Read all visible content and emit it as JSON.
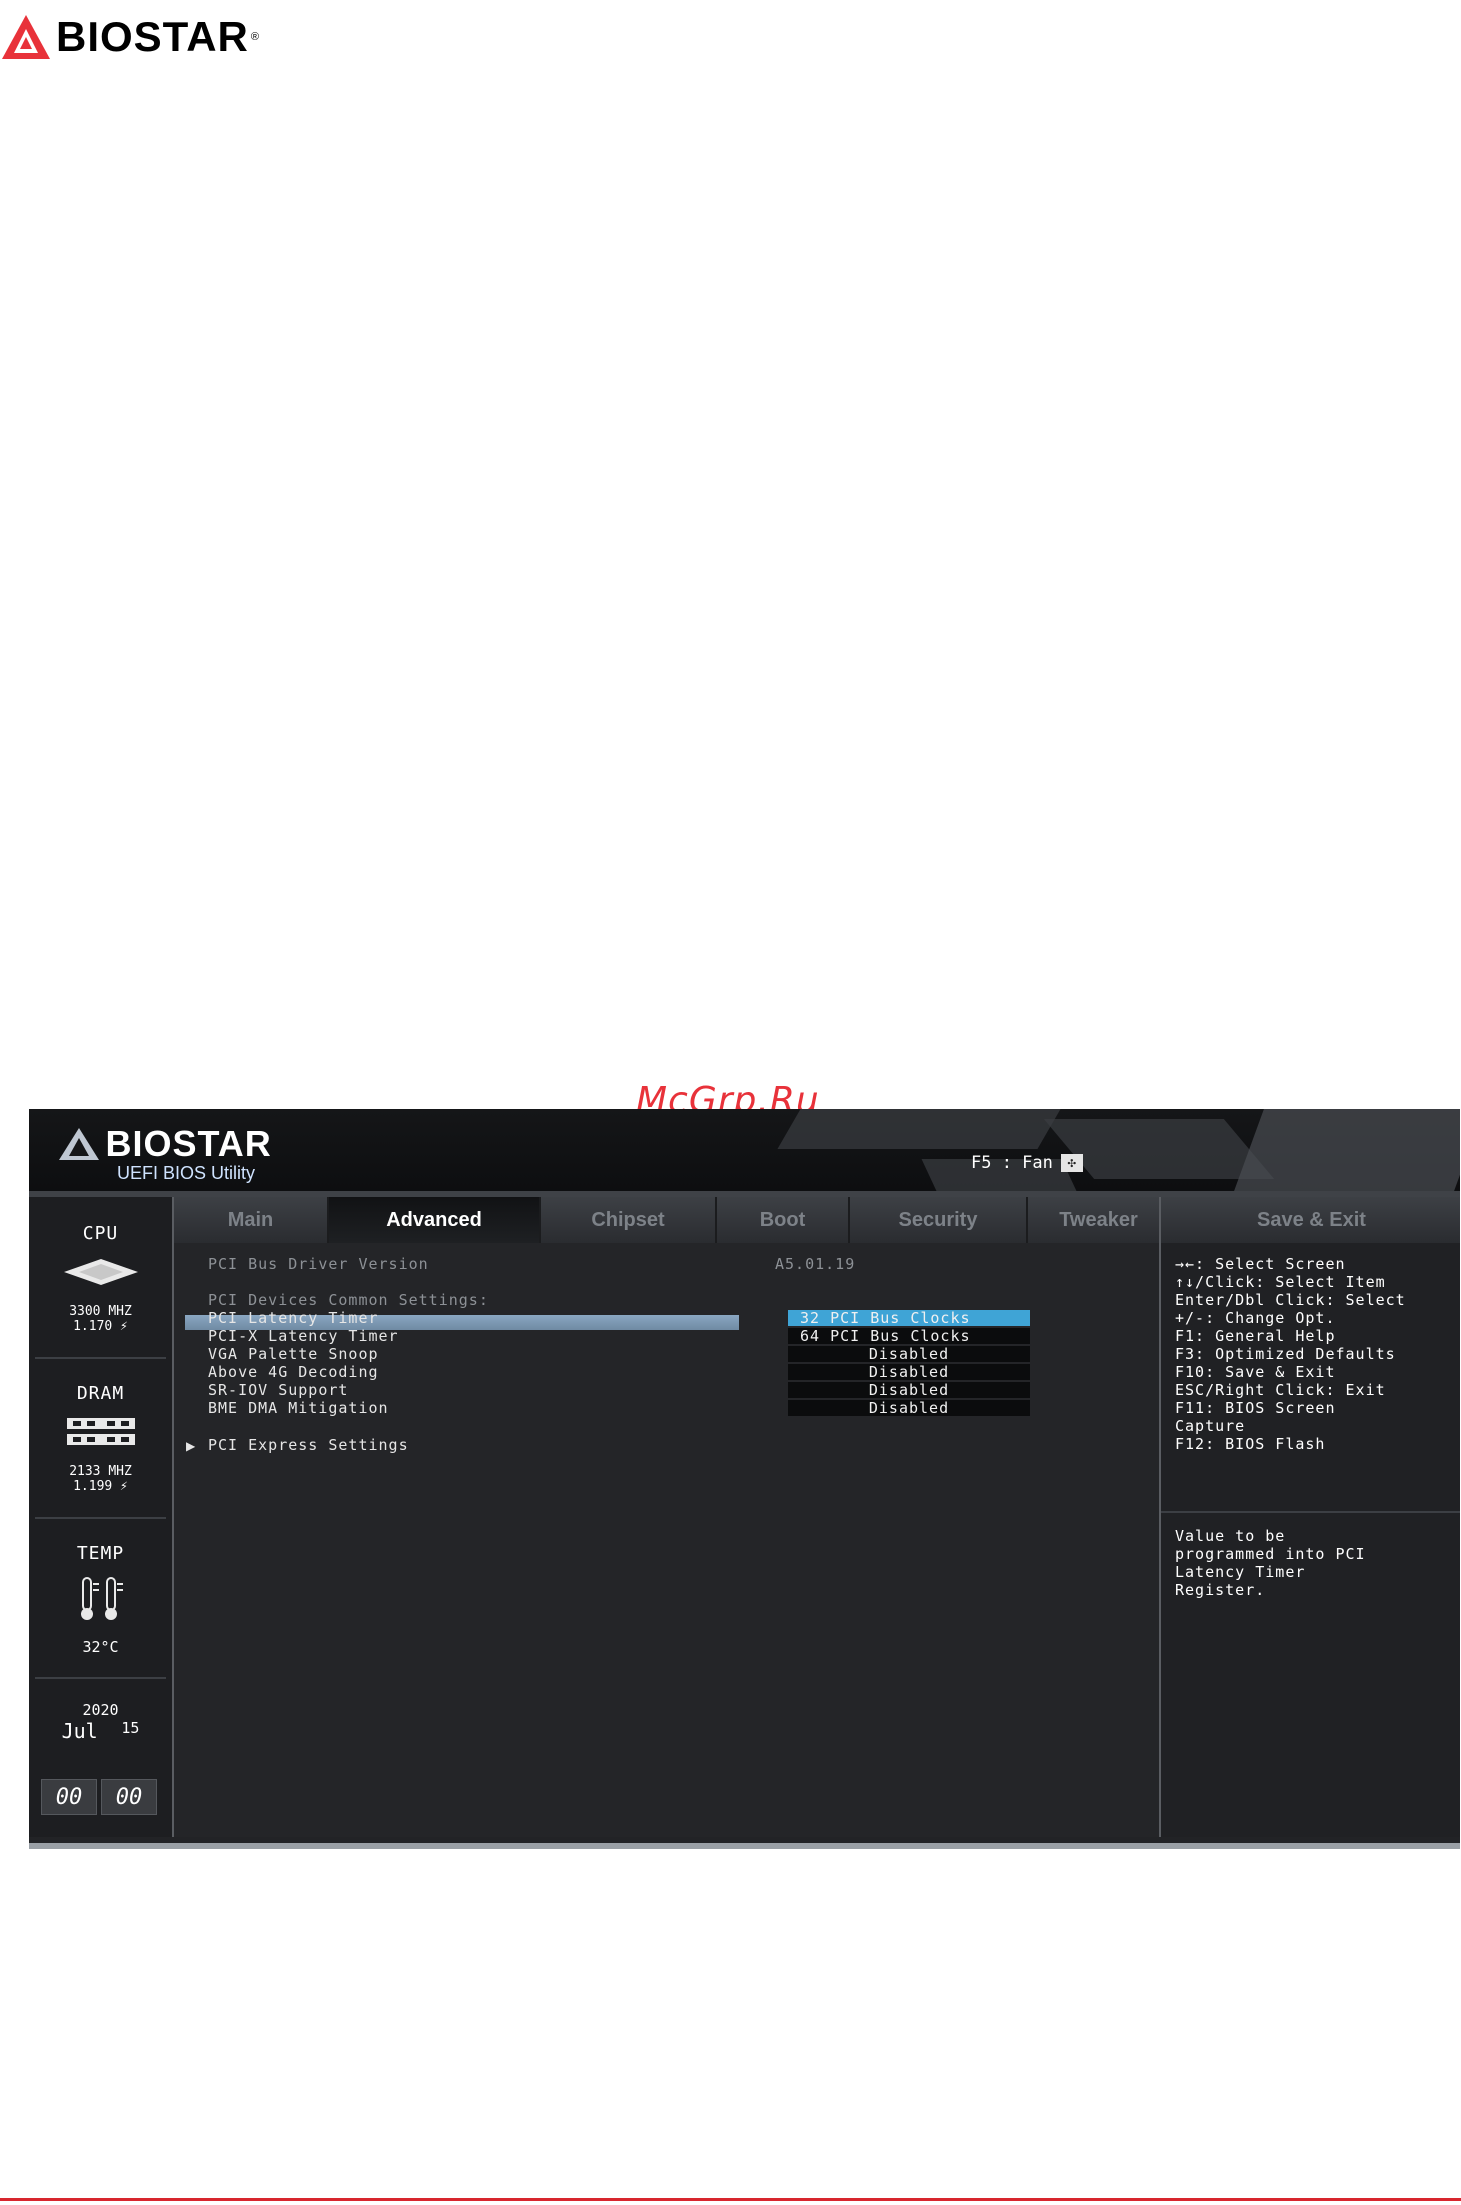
{
  "page": {
    "brand": "BIOSTAR",
    "watermark": "McGrp.Ru"
  },
  "bios": {
    "header": {
      "brand": "BIOSTAR",
      "subtitle": "UEFI BIOS Utility",
      "fan_hotkey": "F5 : Fan"
    },
    "sidebar": {
      "cpu": {
        "title": "CPU",
        "freq": "3300 MHZ",
        "volt": "1.170 ⚡"
      },
      "dram": {
        "title": "DRAM",
        "freq": "2133 MHZ",
        "volt": "1.199 ⚡"
      },
      "temp": {
        "title": "TEMP",
        "value": "32°C"
      },
      "date": {
        "year": "2020",
        "month": "Jul",
        "day": "15"
      },
      "clock": {
        "hours": "00",
        "minutes": "00"
      }
    },
    "tabs": [
      {
        "label": "Main"
      },
      {
        "label": "Advanced"
      },
      {
        "label": "Chipset"
      },
      {
        "label": "Boot"
      },
      {
        "label": "Security"
      },
      {
        "label": "Tweaker"
      },
      {
        "label": "Save & Exit"
      }
    ],
    "content": {
      "driver_label": "PCI Bus Driver Version",
      "driver_value": "A5.01.19",
      "common_heading": "PCI Devices Common Settings:",
      "settings": [
        {
          "label": "PCI Latency Timer",
          "value": "32 PCI Bus Clocks"
        },
        {
          "label": "PCI-X Latency Timer",
          "value": "64 PCI Bus Clocks"
        },
        {
          "label": "VGA Palette Snoop",
          "value": "Disabled"
        },
        {
          "label": "Above 4G Decoding",
          "value": "Disabled"
        },
        {
          "label": "SR-IOV Support",
          "value": "Disabled"
        },
        {
          "label": "BME DMA Mitigation",
          "value": "Disabled"
        }
      ],
      "submenu": "PCI Express Settings"
    },
    "help": {
      "keys": [
        "→←: Select Screen",
        "↑↓/Click: Select Item",
        "Enter/Dbl Click: Select",
        "+/-: Change Opt.",
        "F1: General Help",
        "F3: Optimized Defaults",
        "F10: Save & Exit",
        "ESC/Right Click: Exit",
        "F11: BIOS Screen",
        "Capture",
        "F12: BIOS Flash"
      ],
      "description": [
        "Value to be",
        "programmed into PCI",
        "Latency Timer",
        "Register."
      ]
    }
  },
  "colors": {
    "brand_red": "#e8323a",
    "highlight_blue": "#3fa4d6",
    "selection_bar": "#8aa7c2"
  }
}
